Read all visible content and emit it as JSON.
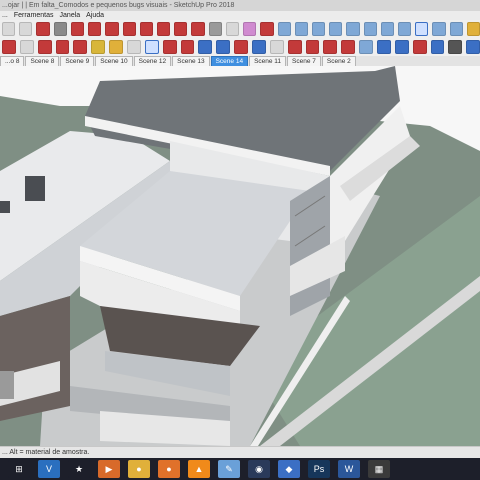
{
  "window": {
    "title": "...ojar | | Em falta_Comodos e pequenos bugs visuais - SketchUp Pro 2018"
  },
  "menu": [
    "...",
    "Ferramentas",
    "Janela",
    "Ajuda"
  ],
  "toolbar1": [
    {
      "icon": "select-icon",
      "color": "#d8d8d8"
    },
    {
      "icon": "rectangle-icon",
      "color": "#d8d8d8"
    },
    {
      "icon": "circle-icon",
      "color": "#c33a3a"
    },
    {
      "icon": "polygon-icon",
      "color": "#8a8a8a"
    },
    {
      "icon": "arc-icon",
      "color": "#c33a3a"
    },
    {
      "icon": "pie-icon",
      "color": "#c33a3a"
    },
    {
      "icon": "push-pull-icon",
      "color": "#c33a3a"
    },
    {
      "icon": "move-icon",
      "color": "#c33a3a"
    },
    {
      "icon": "rotate-icon",
      "color": "#c33a3a"
    },
    {
      "icon": "follow-me-icon",
      "color": "#c33a3a"
    },
    {
      "icon": "offset-icon",
      "color": "#c33a3a"
    },
    {
      "icon": "scale-icon",
      "color": "#c33a3a"
    },
    {
      "icon": "intersect-icon",
      "color": "#9a9a9a"
    },
    {
      "icon": "sandbox-icon",
      "color": "#d8d8d8"
    },
    {
      "icon": "eraser-icon",
      "color": "#d08bd0"
    },
    {
      "icon": "paint-icon",
      "color": "#c33a3a"
    },
    {
      "icon": "iso-view-icon",
      "color": "#7fa8d6"
    },
    {
      "icon": "top-view-icon",
      "color": "#7fa8d6"
    },
    {
      "icon": "front-view-icon",
      "color": "#7fa8d6"
    },
    {
      "icon": "right-view-icon",
      "color": "#7fa8d6"
    },
    {
      "icon": "back-view-icon",
      "color": "#7fa8d6"
    },
    {
      "icon": "left-view-icon",
      "color": "#7fa8d6"
    },
    {
      "icon": "xray-icon",
      "color": "#7fa8d6"
    },
    {
      "icon": "wireframe-icon",
      "color": "#7fa8d6"
    },
    {
      "icon": "shaded-icon",
      "color": "#555555",
      "active": true
    },
    {
      "icon": "textured-icon",
      "color": "#7fa8d6"
    },
    {
      "icon": "monochrome-icon",
      "color": "#7fa8d6"
    },
    {
      "icon": "section-icon",
      "color": "#e0b03a"
    }
  ],
  "toolbar2": [
    {
      "icon": "orbit-icon",
      "color": "#c33a3a"
    },
    {
      "icon": "pan-icon",
      "color": "#d8d8d8"
    },
    {
      "icon": "undo-icon",
      "color": "#c33a3a"
    },
    {
      "icon": "redo-icon",
      "color": "#c33a3a"
    },
    {
      "icon": "tape-measure-icon",
      "color": "#c33a3a"
    },
    {
      "icon": "protractor-icon",
      "color": "#d8b63a"
    },
    {
      "icon": "text-icon",
      "color": "#e0b03a"
    },
    {
      "icon": "axes-icon",
      "color": "#d8d8d8"
    },
    {
      "icon": "dimensions-icon",
      "color": "#d8d8d8",
      "active": true
    },
    {
      "icon": "walk-icon",
      "color": "#c33a3a"
    },
    {
      "icon": "position-camera-icon",
      "color": "#c33a3a"
    },
    {
      "icon": "zoom-icon",
      "color": "#3b6fc4"
    },
    {
      "icon": "zoom-window-icon",
      "color": "#3b6fc4"
    },
    {
      "icon": "zoom-extents-icon",
      "color": "#c33a3a"
    },
    {
      "icon": "look-around-icon",
      "color": "#3b6fc4"
    },
    {
      "icon": "previous-view-icon",
      "color": "#d8d8d8"
    },
    {
      "icon": "outliner-icon",
      "color": "#c33a3a"
    },
    {
      "icon": "components-icon",
      "color": "#c33a3a"
    },
    {
      "icon": "materials-icon",
      "color": "#c33a3a"
    },
    {
      "icon": "styles-icon",
      "color": "#c33a3a"
    },
    {
      "icon": "layers-icon",
      "color": "#7fa8d6"
    },
    {
      "icon": "scenes-icon",
      "color": "#3b6fc4"
    },
    {
      "icon": "shadows-icon",
      "color": "#3b6fc4"
    },
    {
      "icon": "fog-icon",
      "color": "#c33a3a"
    },
    {
      "icon": "match-photo-icon",
      "color": "#3b6fc4"
    },
    {
      "icon": "soften-edges-icon",
      "color": "#555555"
    },
    {
      "icon": "instructor-icon",
      "color": "#3b6fc4"
    }
  ],
  "scenes": [
    {
      "label": "...o 8",
      "active": false
    },
    {
      "label": "Scene 8",
      "active": false
    },
    {
      "label": "Scene 9",
      "active": false
    },
    {
      "label": "Scene 10",
      "active": false
    },
    {
      "label": "Scene 12",
      "active": false
    },
    {
      "label": "Scene 13",
      "active": false
    },
    {
      "label": "Scene 14",
      "active": true
    },
    {
      "label": "Scene 11",
      "active": false
    },
    {
      "label": "Scene 7",
      "active": false
    },
    {
      "label": "Scene 2",
      "active": false
    }
  ],
  "status": {
    "text": "... Alt = material de amostra."
  },
  "taskbar": [
    {
      "icon": "windows-start-icon",
      "color": "#1d1f2a",
      "glyph": "⊞"
    },
    {
      "icon": "visual-studio-icon",
      "color": "#2a6fbf",
      "glyph": "V"
    },
    {
      "icon": "star-app-icon",
      "color": "#1d1f2a",
      "glyph": "★"
    },
    {
      "icon": "media-player-icon",
      "color": "#d86a2a",
      "glyph": "▶"
    },
    {
      "icon": "chrome-icon",
      "color": "#e0b03a",
      "glyph": "●"
    },
    {
      "icon": "firefox-icon",
      "color": "#e0712a",
      "glyph": "●"
    },
    {
      "icon": "vlc-icon",
      "color": "#f08a1a",
      "glyph": "▲"
    },
    {
      "icon": "paint-app-icon",
      "color": "#6aa0d8",
      "glyph": "✎"
    },
    {
      "icon": "steam-icon",
      "color": "#2a3a5a",
      "glyph": "◉"
    },
    {
      "icon": "app-icon",
      "color": "#3b6fc4",
      "glyph": "◆"
    },
    {
      "icon": "photoshop-icon",
      "color": "#16365a",
      "glyph": "Ps"
    },
    {
      "icon": "word-icon",
      "color": "#2b579a",
      "glyph": "W"
    },
    {
      "icon": "app-grid-icon",
      "color": "#3a3a3a",
      "glyph": "▦"
    }
  ]
}
